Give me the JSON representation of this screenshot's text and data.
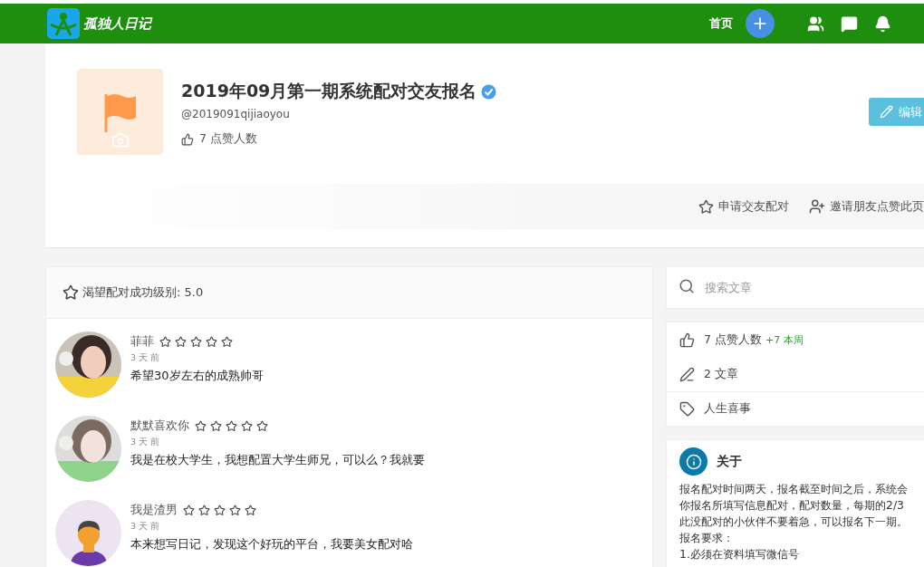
{
  "header": {
    "logo_text": "孤独人日记",
    "nav": [
      {
        "label": "首页"
      }
    ]
  },
  "profile": {
    "title": "2019年09月第一期系统配对交友报名",
    "verified": true,
    "handle": "@2019091qijiaoyou",
    "likes": "7 点赞人数",
    "edit_button": "编辑",
    "actions": [
      {
        "kind": "star",
        "label": "申请交友配对"
      },
      {
        "kind": "invite",
        "label": "邀请朋友点赞此页"
      }
    ]
  },
  "wishes": {
    "heading": "渴望配对成功级别: 5.0",
    "comments": [
      {
        "name": "菲菲",
        "stars": 0,
        "time": "3 天 前",
        "text": "希望30岁左右的成熟帅哥",
        "kind": "picture"
      },
      {
        "name": "默默喜欢你",
        "stars": 0,
        "time": "3 天 前",
        "text": "我是在校大学生，我想配置大学生师兄，可以么？我就要",
        "kind": "picture"
      },
      {
        "name": "我是渣男",
        "stars": 0,
        "time": "3 天 前",
        "text": "本来想写日记，发现这个好玩的平台，我要美女配对哈",
        "kind": "figure"
      }
    ]
  },
  "sidebar": {
    "search": {
      "placeholder": "搜索文章"
    },
    "stats": [
      {
        "kind": "likes",
        "label": "7 点赞人数",
        "extra": "+7 本周"
      },
      {
        "kind": "posts",
        "label": "2 文章"
      },
      {
        "kind": "tag",
        "label": "人生喜事"
      }
    ],
    "about": {
      "title": "关于",
      "lines": [
        "报名配对时间两天，报名截至时间之后，系统会",
        "你报名所填写信息配对，配对数量，每期的2/3",
        "此没配对的小伙伴不要着急，可以报名下一期。",
        "报名要求：",
        "1.必须在资料填写微信号"
      ]
    }
  }
}
